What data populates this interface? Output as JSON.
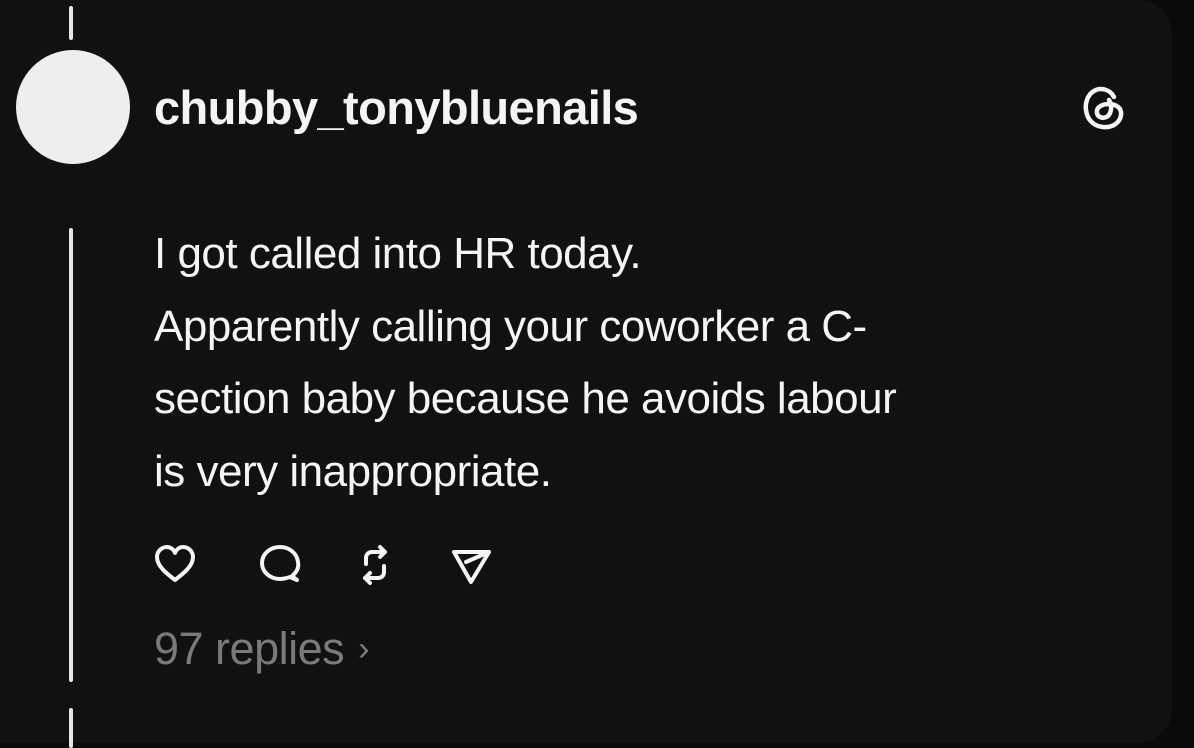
{
  "post": {
    "username": "chubby_tonybluenails",
    "text_lines": [
      "I got called into HR today.",
      "Apparently calling your coworker a C-",
      "section baby because he avoids labour",
      "is very inappropriate."
    ],
    "replies_label": "97 replies",
    "replies_chevron": "›"
  },
  "icons": {
    "logo": "threads-logo-icon",
    "like": "heart-icon",
    "comment": "comment-bubble-icon",
    "repost": "repost-icon",
    "share": "send-icon"
  },
  "colors": {
    "background": "#111111",
    "text": "#f5f5f5",
    "muted": "#7a7a7a",
    "avatar": "#eeeeee"
  }
}
